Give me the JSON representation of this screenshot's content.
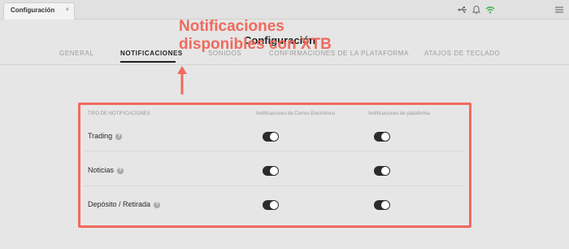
{
  "window": {
    "tab_title": "Configuración",
    "tab_close": "×"
  },
  "toolbar_icons": [
    "usb-icon",
    "bell-icon",
    "wifi-icon",
    "menu-icon"
  ],
  "page": {
    "title": "Configuración"
  },
  "nav": {
    "tabs": [
      {
        "label": "GENERAL"
      },
      {
        "label": "NOTIFICACIONES"
      },
      {
        "label": "SONIDOS"
      },
      {
        "label": "CONFIRMACIONES DE LA PLATAFORMA"
      },
      {
        "label": "ATAJOS DE TECLADO"
      }
    ],
    "active": "NOTIFICACIONES"
  },
  "notifications": {
    "header_type": "TIPO DE NOTIFICACIONES",
    "header_email": "Notificaciones de Correo Electrónico",
    "header_platform": "Notificaciones de plataforma",
    "rows": [
      {
        "label": "Trading",
        "help": "?",
        "email_on": true,
        "platform_on": true
      },
      {
        "label": "Noticias",
        "help": "?",
        "email_on": true,
        "platform_on": true
      },
      {
        "label": "Depósito / Retirada",
        "help": "?",
        "email_on": true,
        "platform_on": true
      }
    ]
  },
  "annotation": {
    "line1": "Notificaciones",
    "line2": "disponibles con XTB",
    "color": "#f06a5e"
  }
}
